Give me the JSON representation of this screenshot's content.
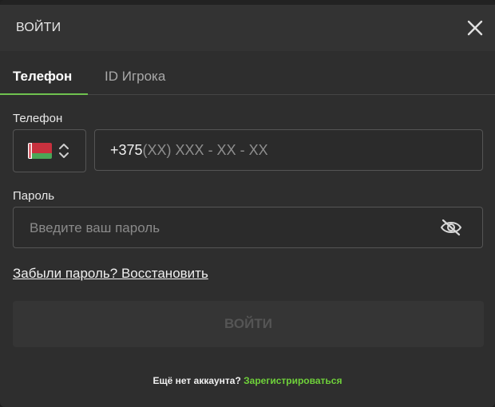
{
  "header": {
    "title": "ВОЙТИ",
    "close_icon": "close-icon"
  },
  "tabs": [
    {
      "label": "Телефон",
      "active": true
    },
    {
      "label": "ID Игрока",
      "active": false
    }
  ],
  "colors": {
    "accent_green": "#6fc24f",
    "link_green": "#6fd13a",
    "background": "#2e2e2e",
    "header_bg": "#333333"
  },
  "form": {
    "phone_label": "Телефон",
    "country": {
      "flag_icon": "belarus-flag-icon",
      "chevron_icon": "chevron-up-down-icon"
    },
    "phone": {
      "prefix": "+375",
      "mask": "(XX) XXX - XX - XX"
    },
    "password_label": "Пароль",
    "password_placeholder": "Введите ваш пароль",
    "eye_icon": "eye-off-icon",
    "forgot_link": "Забыли пароль? Восстановить",
    "submit_label": "ВОЙТИ"
  },
  "footer": {
    "question": "Ещё нет аккаунта?",
    "register_link": "Зарегистрироваться"
  }
}
